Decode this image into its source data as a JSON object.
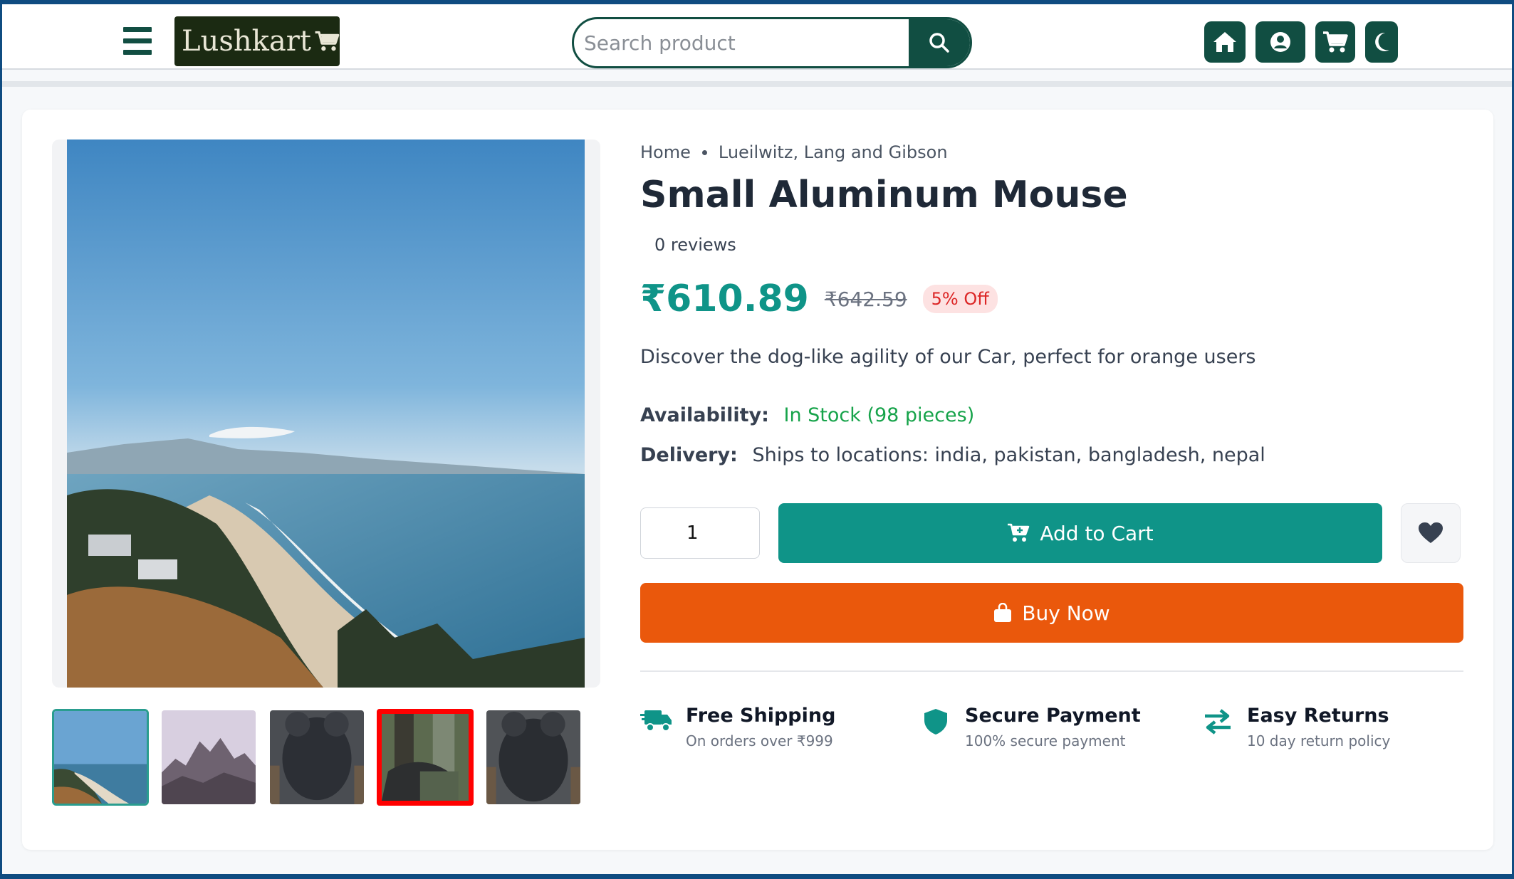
{
  "navbar": {
    "logo_text": "Lushkart",
    "search_placeholder": "Search product",
    "icons": [
      "home-icon",
      "user-icon",
      "cart-icon",
      "moon-icon"
    ]
  },
  "breadcrumb": {
    "home": "Home",
    "brand": "Lueilwitz, Lang and Gibson"
  },
  "product": {
    "title": "Small Aluminum Mouse",
    "reviews": "0 reviews",
    "price": "₹610.89",
    "old_price": "₹642.59",
    "discount": "5% Off",
    "description": "Discover the dog-like agility of our Car, perfect for orange users",
    "availability_label": "Availability:",
    "availability_value": "In Stock (98 pieces)",
    "delivery_label": "Delivery:",
    "delivery_value": "Ships to locations: india, pakistan, bangladesh, nepal",
    "quantity": "1"
  },
  "actions": {
    "add_to_cart": "Add to Cart",
    "buy_now": "Buy Now"
  },
  "features": [
    {
      "title": "Free Shipping",
      "subtitle": "On orders over ₹999"
    },
    {
      "title": "Secure Payment",
      "subtitle": "100% secure payment"
    },
    {
      "title": "Easy Returns",
      "subtitle": "10 day return policy"
    }
  ],
  "colors": {
    "brand_dark": "#114e42",
    "primary": "#0f9488",
    "buy_now": "#ea580c",
    "discount_text": "#dc2626",
    "in_stock": "#16a34a"
  }
}
